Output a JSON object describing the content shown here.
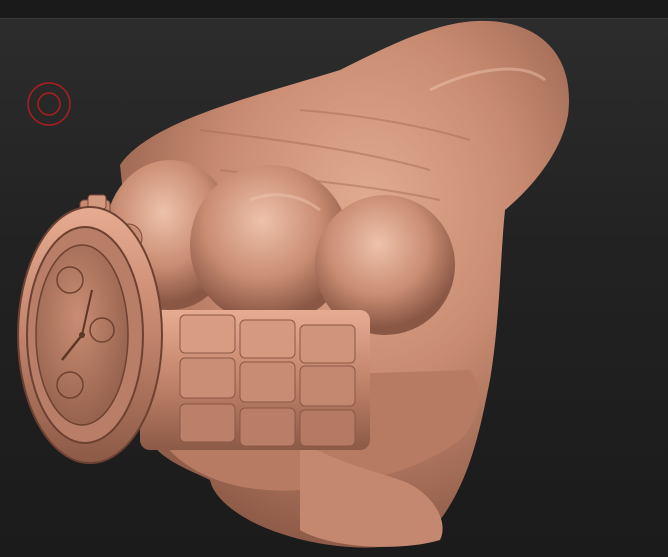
{
  "viewport": {
    "background_top": "#2d2d2d",
    "background_bottom": "#1b1b1b",
    "material_color": "#c98d73"
  },
  "brush": {
    "icon": "brush-cursor-icon",
    "color": "#b01c1c"
  }
}
